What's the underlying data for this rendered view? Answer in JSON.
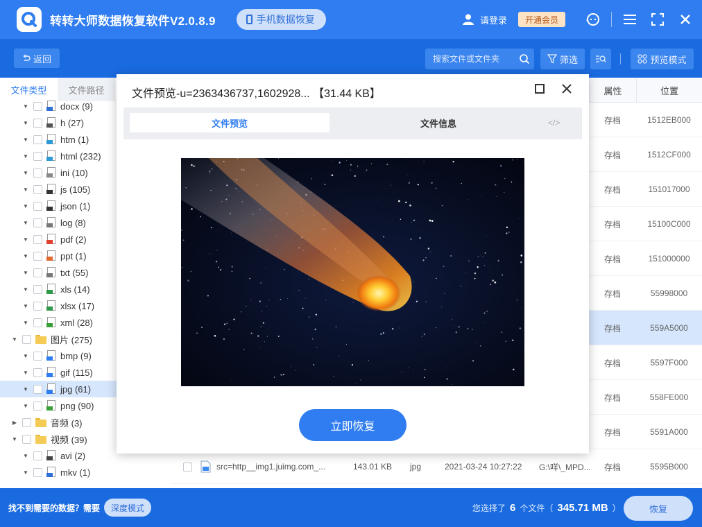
{
  "app": {
    "title": "转转大师数据恢复软件V2.0.8.9",
    "phone_recovery": "手机数据恢复",
    "login": "请登录",
    "vip": "开通会员",
    "brand_color": "#2f7df0"
  },
  "toolbar": {
    "back": "返回",
    "search_placeholder": "搜索文件或文件夹",
    "filter": "筛选",
    "preview_mode": "预览模式"
  },
  "sidebar": {
    "tabs": [
      "文件类型",
      "文件路径"
    ],
    "items": [
      {
        "label": "docx (9)",
        "icon": "docx-file-icon"
      },
      {
        "label": "h (27)",
        "icon": "h-file-icon"
      },
      {
        "label": "htm (1)",
        "icon": "htm-file-icon"
      },
      {
        "label": "html (232)",
        "icon": "html-file-icon"
      },
      {
        "label": "ini (10)",
        "icon": "ini-file-icon"
      },
      {
        "label": "js (105)",
        "icon": "js-file-icon"
      },
      {
        "label": "json (1)",
        "icon": "json-file-icon"
      },
      {
        "label": "log (8)",
        "icon": "log-file-icon"
      },
      {
        "label": "pdf (2)",
        "icon": "pdf-file-icon"
      },
      {
        "label": "ppt (1)",
        "icon": "ppt-file-icon"
      },
      {
        "label": "txt (55)",
        "icon": "txt-file-icon"
      },
      {
        "label": "xls (14)",
        "icon": "xls-file-icon"
      },
      {
        "label": "xlsx (17)",
        "icon": "xlsx-file-icon"
      },
      {
        "label": "xml (28)",
        "icon": "xml-file-icon"
      },
      {
        "label": "图片 (275)",
        "icon": "folder-icon"
      },
      {
        "label": "bmp (9)",
        "icon": "bmp-file-icon"
      },
      {
        "label": "gif (115)",
        "icon": "gif-file-icon"
      },
      {
        "label": "jpg (61)",
        "icon": "jpg-file-icon"
      },
      {
        "label": "png (90)",
        "icon": "png-file-icon"
      },
      {
        "label": "音频 (3)",
        "icon": "folder-icon"
      },
      {
        "label": "视频 (39)",
        "icon": "folder-icon"
      },
      {
        "label": "avi (2)",
        "icon": "avi-file-icon"
      },
      {
        "label": "mkv (1)",
        "icon": "mkv-file-icon"
      }
    ]
  },
  "list": {
    "col_attr": "属性",
    "col_pos": "位置",
    "rows": [
      {
        "attr": "存档",
        "pos": "1512EB000"
      },
      {
        "attr": "存档",
        "pos": "1512CF000"
      },
      {
        "attr": "存档",
        "pos": "151017000"
      },
      {
        "attr": "存档",
        "pos": "15100C000"
      },
      {
        "attr": "存档",
        "pos": "151000000"
      },
      {
        "attr": "存档",
        "pos": "55998000"
      },
      {
        "attr": "存档",
        "pos": "559A5000"
      },
      {
        "attr": "存档",
        "pos": "5597F000"
      },
      {
        "attr": "存档",
        "pos": "558FE000"
      },
      {
        "attr": "存档",
        "pos": "5591A000"
      }
    ],
    "last_row": {
      "name": "src=http__img1.juimg.com_...",
      "size": "143.01 KB",
      "type": "jpg",
      "date": "2021-03-24 10:27:22",
      "path": "G:\\咩\\_MPD...",
      "attr": "存档",
      "pos": "5595B000"
    }
  },
  "bottom": {
    "hint": "找不到需要的数据？需要",
    "deep_mode": "深度模式",
    "selected_prefix": "您选择了",
    "selected_count": "6",
    "selected_mid": "个文件（",
    "selected_size": "345.71 MB",
    "selected_suffix": "）",
    "recover": "恢复"
  },
  "modal": {
    "title": "文件预览-u=2363436737,1602928... 【31.44 KB】",
    "tab_preview": "文件预览",
    "tab_info": "文件信息",
    "code_icon": "</>",
    "recover_now": "立即恢复"
  }
}
